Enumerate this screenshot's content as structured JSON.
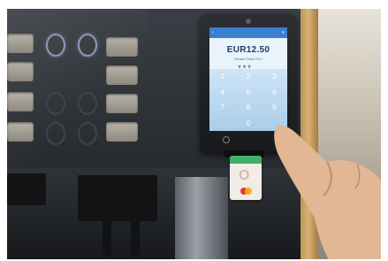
{
  "terminal": {
    "amount": "EUR12.50",
    "prompt": "Please Enter Pin !",
    "pin_mask": "***_",
    "keypad": [
      "1",
      "2",
      "3",
      "4",
      "5",
      "6",
      "7",
      "8",
      "9",
      "",
      "0",
      ""
    ]
  },
  "card": {
    "logo_text": "O"
  }
}
